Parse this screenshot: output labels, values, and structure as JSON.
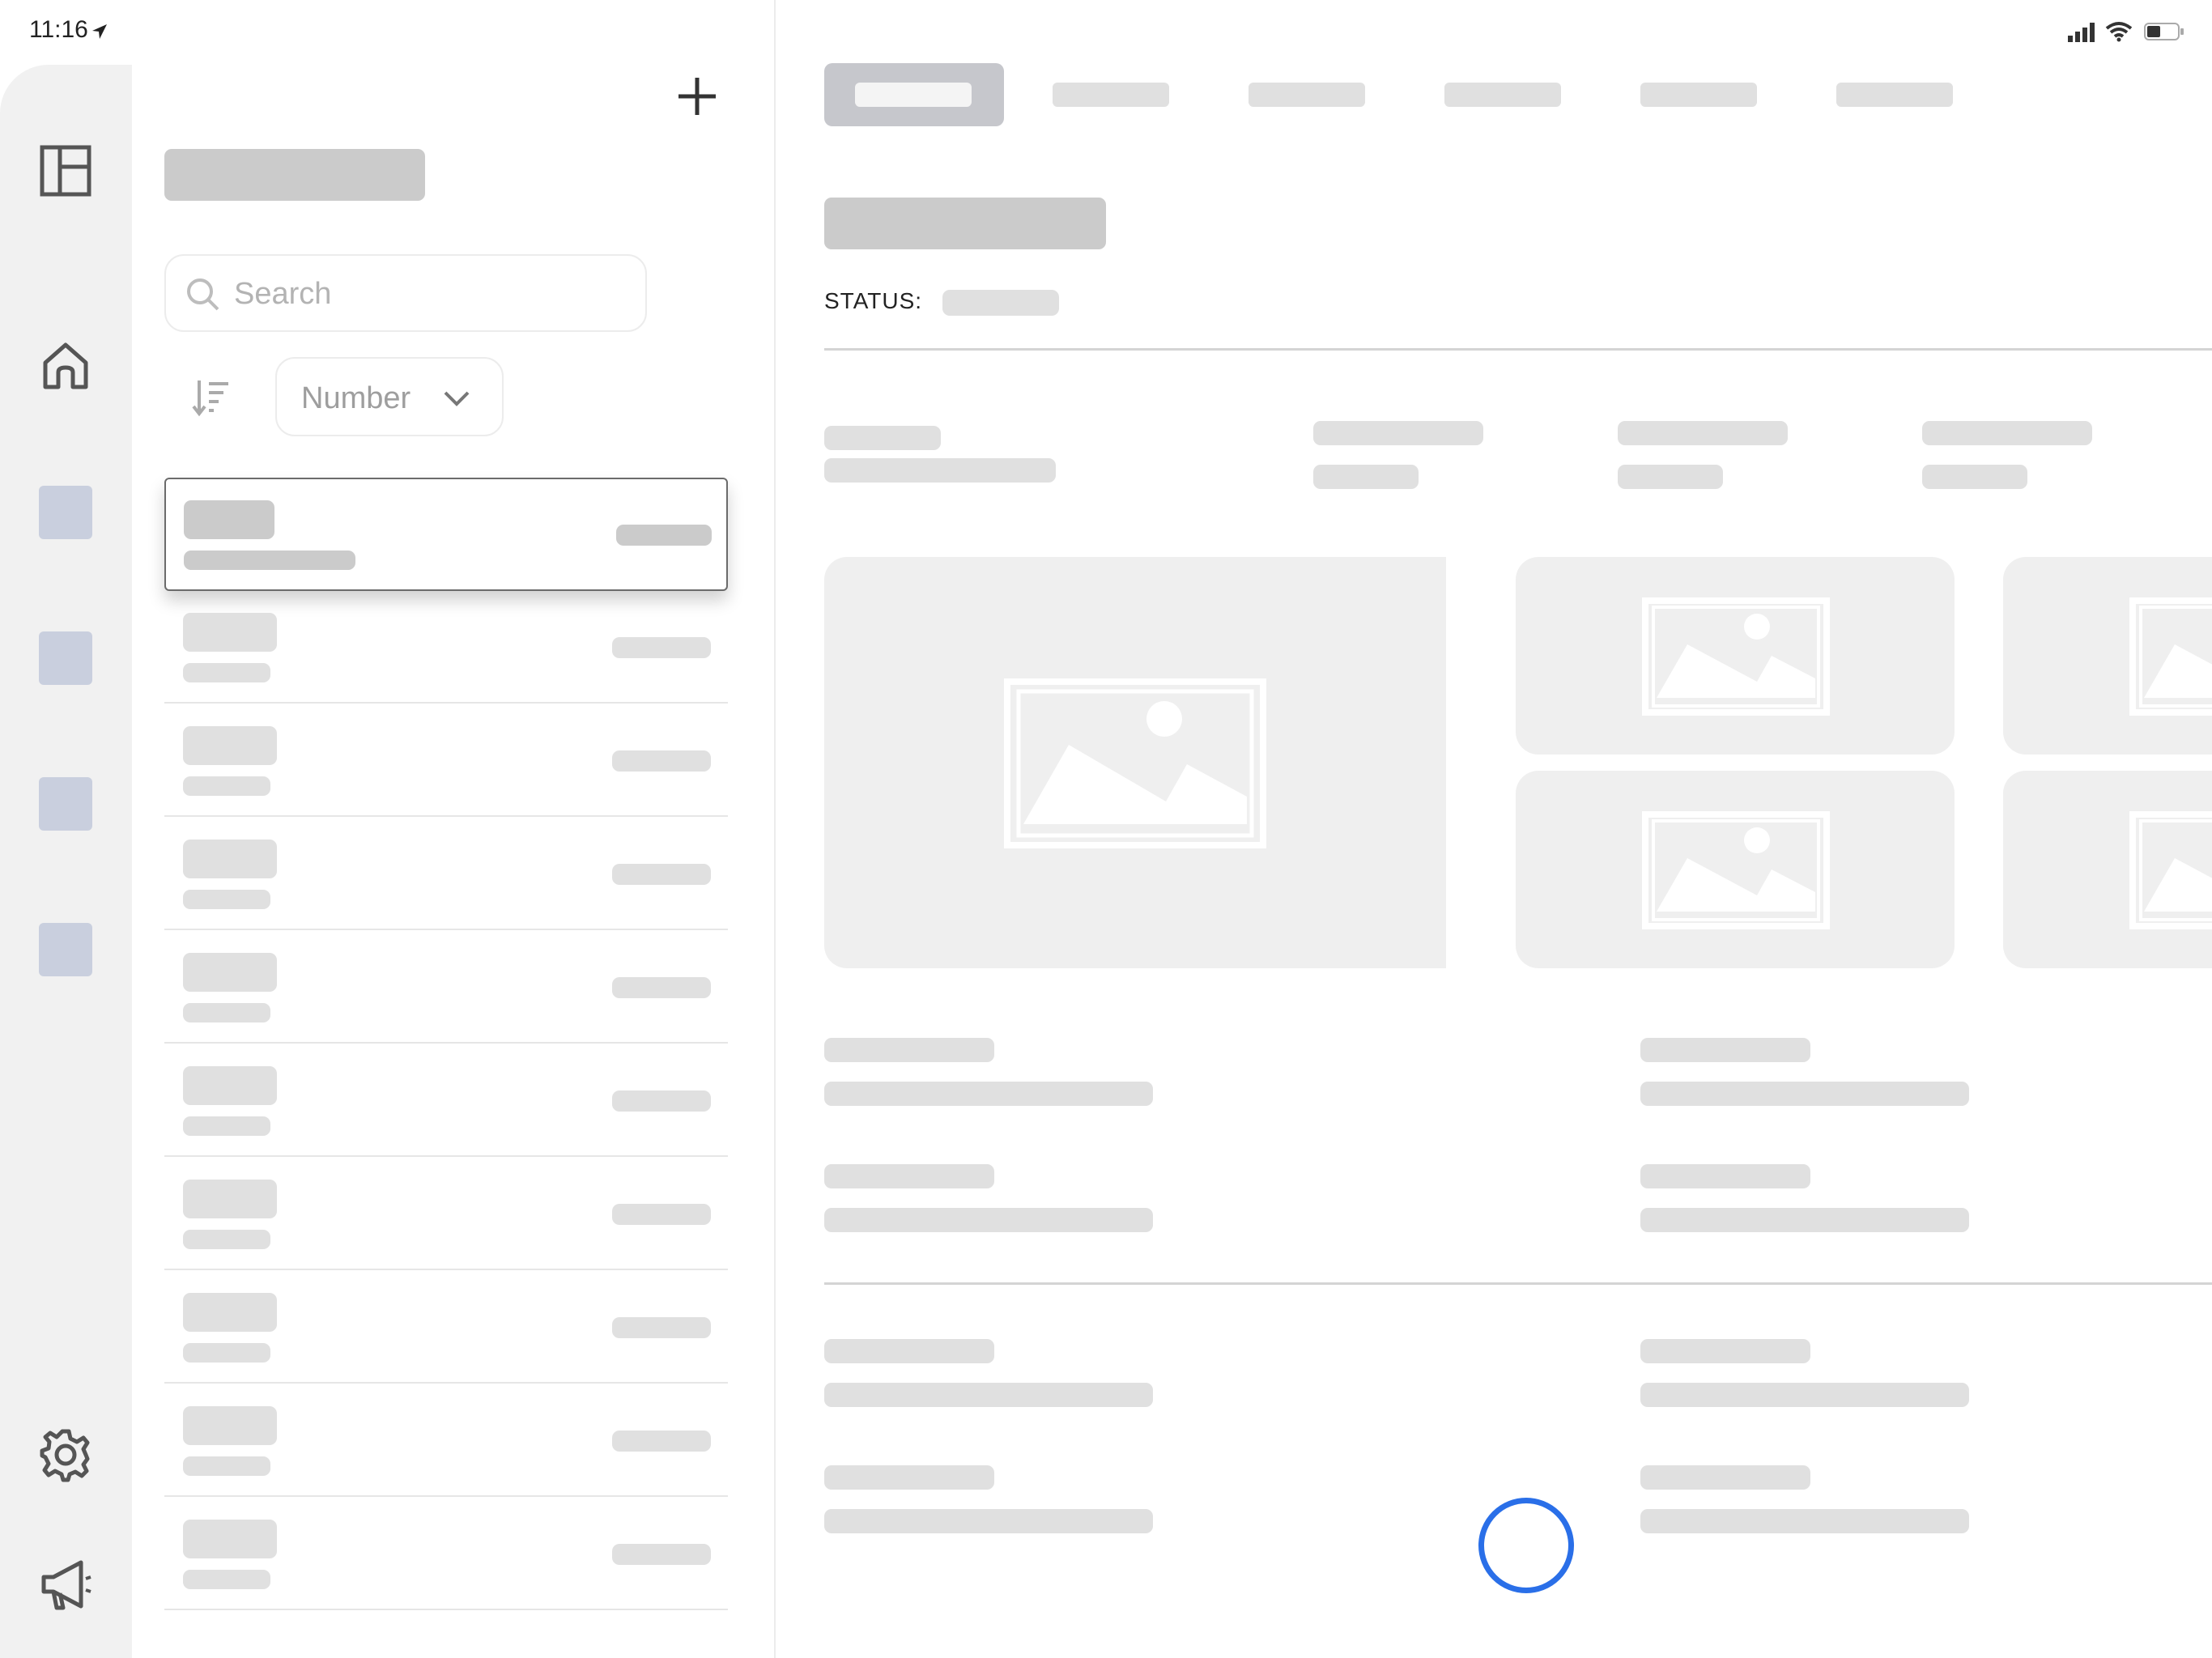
{
  "status_bar": {
    "time": "11:16"
  },
  "list": {
    "search_placeholder": "Search",
    "sort_select_value": "Number"
  },
  "detail": {
    "status_label": "STATUS:"
  },
  "colors": {
    "accent_blue": "#2a6fe8",
    "rail_square": "#c9cfde",
    "placeholder": "#d6d6d6"
  },
  "icons": {
    "rail": [
      "sidebar-layout-icon",
      "home-icon",
      "gear-icon",
      "megaphone-icon"
    ],
    "list": [
      "plus-icon",
      "search-icon",
      "sort-icon",
      "chevron-down-icon"
    ]
  }
}
